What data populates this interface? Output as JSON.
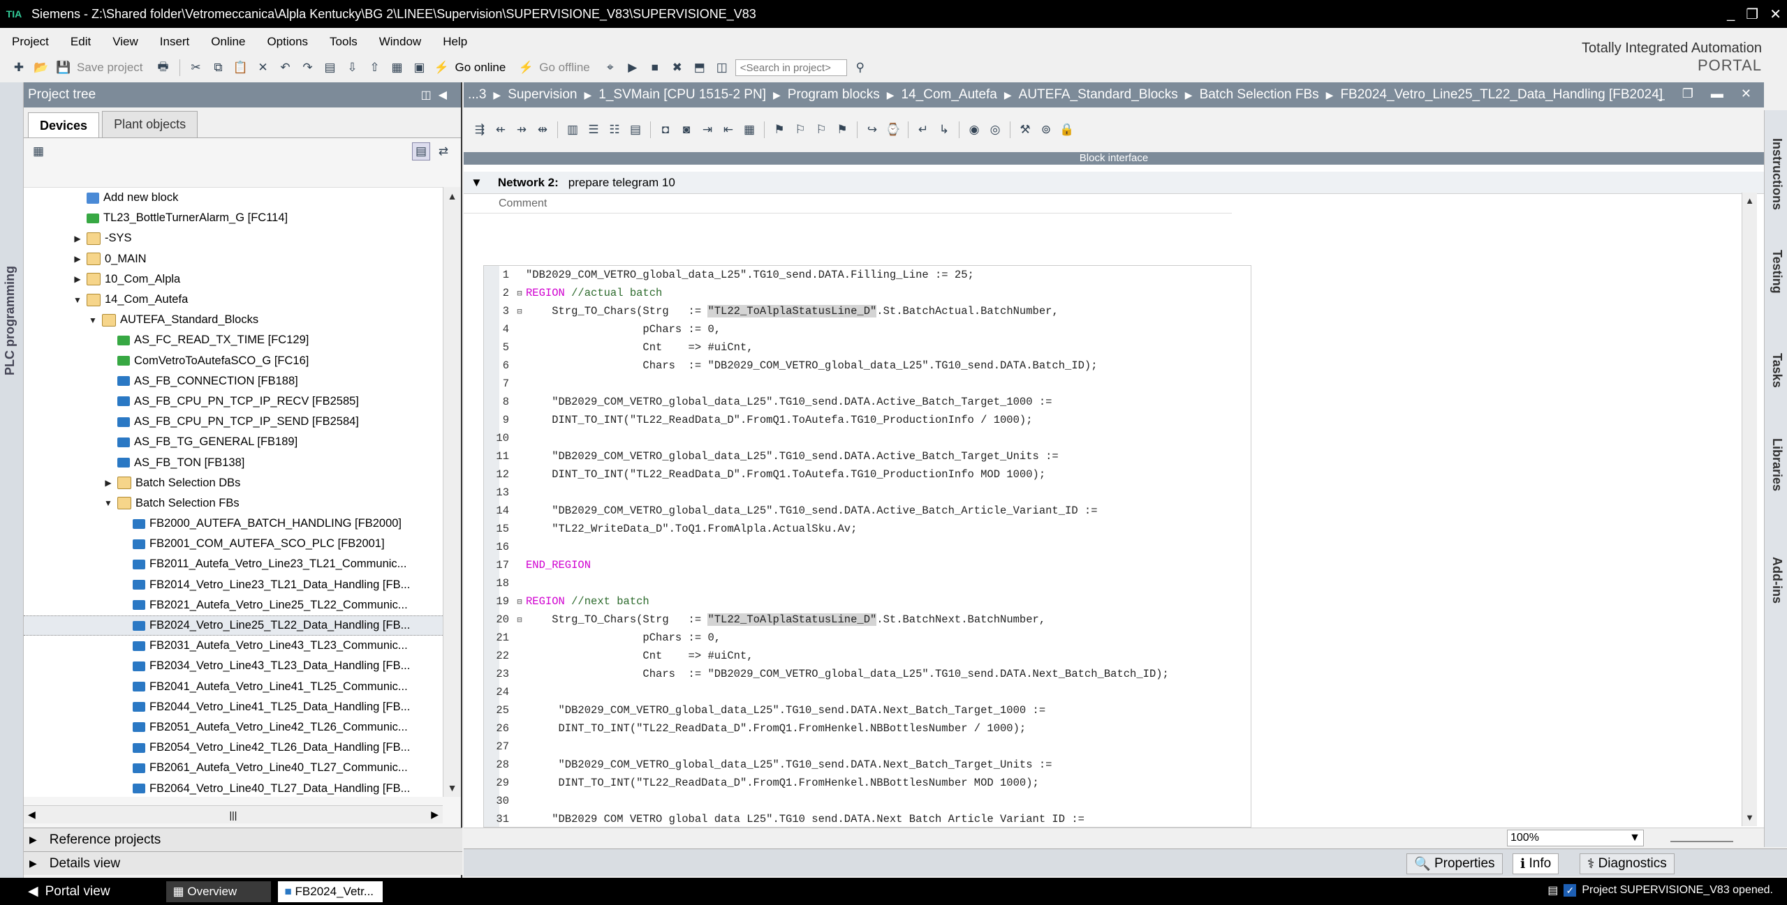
{
  "window": {
    "title": "Siemens  -  Z:\\Shared folder\\Vetromeccanica\\Alpla Kentucky\\BG 2\\LINEE\\Supervision\\SUPERVISIONE_V83\\SUPERVISIONE_V83",
    "minimize": "_",
    "restore": "❐",
    "close": "✕"
  },
  "menu": [
    "Project",
    "Edit",
    "View",
    "Insert",
    "Online",
    "Options",
    "Tools",
    "Window",
    "Help"
  ],
  "toolbar": {
    "save_label": "Save project",
    "go_online_label": "Go online",
    "go_offline_label": "Go offline",
    "search_placeholder": "<Search in project>"
  },
  "branding": {
    "line1": "Totally Integrated Automation",
    "line2": "PORTAL"
  },
  "side_strip": {
    "plc_label": "PLC programming"
  },
  "project_tree": {
    "title": "Project tree",
    "tabs": [
      "Devices",
      "Plant objects"
    ],
    "items": [
      {
        "label": "Add new block",
        "type": "add",
        "level": 4
      },
      {
        "label": "TL23_BottleTurnerAlarm_G [FC114]",
        "type": "fc",
        "level": 4
      },
      {
        "label": "-SYS",
        "type": "folder",
        "level": 4,
        "arrow": "▶"
      },
      {
        "label": "0_MAIN",
        "type": "folder",
        "level": 4,
        "arrow": "▶"
      },
      {
        "label": "10_Com_Alpla",
        "type": "folder",
        "level": 4,
        "arrow": "▶"
      },
      {
        "label": "14_Com_Autefa",
        "type": "folder",
        "level": 4,
        "arrow": "▼"
      },
      {
        "label": "AUTEFA_Standard_Blocks",
        "type": "folder",
        "level": 5,
        "arrow": "▼"
      },
      {
        "label": "AS_FC_READ_TX_TIME [FC129]",
        "type": "fc",
        "level": 6
      },
      {
        "label": "ComVetroToAutefaSCO_G [FC16]",
        "type": "fc",
        "level": 6
      },
      {
        "label": "AS_FB_CONNECTION [FB188]",
        "type": "fb",
        "level": 6
      },
      {
        "label": "AS_FB_CPU_PN_TCP_IP_RECV [FB2585]",
        "type": "fb",
        "level": 6
      },
      {
        "label": "AS_FB_CPU_PN_TCP_IP_SEND [FB2584]",
        "type": "fb",
        "level": 6
      },
      {
        "label": "AS_FB_TG_GENERAL [FB189]",
        "type": "fb",
        "level": 6
      },
      {
        "label": "AS_FB_TON [FB138]",
        "type": "fb",
        "level": 6
      },
      {
        "label": "Batch Selection DBs",
        "type": "folder",
        "level": 6,
        "arrow": "▶"
      },
      {
        "label": "Batch Selection FBs",
        "type": "folder",
        "level": 6,
        "arrow": "▼"
      },
      {
        "label": "FB2000_AUTEFA_BATCH_HANDLING [FB2000]",
        "type": "fb",
        "level": 7
      },
      {
        "label": "FB2001_COM_AUTEFA_SCO_PLC [FB2001]",
        "type": "fb",
        "level": 7
      },
      {
        "label": "FB2011_Autefa_Vetro_Line23_TL21_Communic...",
        "type": "fb",
        "level": 7
      },
      {
        "label": "FB2014_Vetro_Line23_TL21_Data_Handling [FB...",
        "type": "fb",
        "level": 7
      },
      {
        "label": "FB2021_Autefa_Vetro_Line25_TL22_Communic...",
        "type": "fb",
        "level": 7
      },
      {
        "label": "FB2024_Vetro_Line25_TL22_Data_Handling [FB...",
        "type": "fb",
        "level": 7,
        "selected": true
      },
      {
        "label": "FB2031_Autefa_Vetro_Line43_TL23_Communic...",
        "type": "fb",
        "level": 7
      },
      {
        "label": "FB2034_Vetro_Line43_TL23_Data_Handling [FB...",
        "type": "fb",
        "level": 7
      },
      {
        "label": "FB2041_Autefa_Vetro_Line41_TL25_Communic...",
        "type": "fb",
        "level": 7
      },
      {
        "label": "FB2044_Vetro_Line41_TL25_Data_Handling [FB...",
        "type": "fb",
        "level": 7
      },
      {
        "label": "FB2051_Autefa_Vetro_Line42_TL26_Communic...",
        "type": "fb",
        "level": 7
      },
      {
        "label": "FB2054_Vetro_Line42_TL26_Data_Handling [FB...",
        "type": "fb",
        "level": 7
      },
      {
        "label": "FB2061_Autefa_Vetro_Line40_TL27_Communic...",
        "type": "fb",
        "level": 7
      },
      {
        "label": "FB2064_Vetro_Line40_TL27_Data_Handling [FB...",
        "type": "fb",
        "level": 7
      }
    ],
    "reference_projects": "Reference projects",
    "details_view": "Details view"
  },
  "editor": {
    "breadcrumb": [
      "...3",
      "Supervision",
      "1_SVMain [CPU 1515-2 PN]",
      "Program blocks",
      "14_Com_Autefa",
      "AUTEFA_Standard_Blocks",
      "Batch Selection FBs",
      "FB2024_Vetro_Line25_TL22_Data_Handling [FB2024]"
    ],
    "block_interface": "Block interface",
    "network_label": "Network 2:",
    "network_title": "prepare telegram 10",
    "comment_label": "Comment",
    "zoom": "100%",
    "code": [
      {
        "n": "1",
        "fold": "",
        "segs": [
          {
            "t": "\"DB2029_COM_VETRO_global_data_L25\".TG10_send.DATA.Filling_Line := 25;"
          }
        ]
      },
      {
        "n": "2",
        "fold": "⊟",
        "segs": [
          {
            "t": "REGION",
            "c": "kw"
          },
          {
            "t": " //actual batch",
            "c": "cm"
          }
        ]
      },
      {
        "n": "3",
        "fold": "⊟",
        "segs": [
          {
            "t": "    Strg_TO_Chars(Strg   := "
          },
          {
            "t": "\"TL22_ToAlplaStatusLine_D\"",
            "c": "hl"
          },
          {
            "t": ".St.BatchActual.BatchNumber,"
          }
        ]
      },
      {
        "n": "4",
        "fold": "",
        "segs": [
          {
            "t": "                  pChars := 0,"
          }
        ]
      },
      {
        "n": "5",
        "fold": "",
        "segs": [
          {
            "t": "                  Cnt    => #uiCnt,"
          }
        ]
      },
      {
        "n": "6",
        "fold": "",
        "segs": [
          {
            "t": "                  Chars  := \"DB2029_COM_VETRO_global_data_L25\".TG10_send.DATA.Batch_ID);"
          }
        ]
      },
      {
        "n": "7",
        "fold": "",
        "segs": [
          {
            "t": ""
          }
        ]
      },
      {
        "n": "8",
        "fold": "",
        "segs": [
          {
            "t": "    \"DB2029_COM_VETRO_global_data_L25\".TG10_send.DATA.Active_Batch_Target_1000 :="
          }
        ]
      },
      {
        "n": "9",
        "fold": "",
        "segs": [
          {
            "t": "    DINT_TO_INT(\"TL22_ReadData_D\".FromQ1.ToAutefa.TG10_ProductionInfo / 1000);"
          }
        ]
      },
      {
        "n": "10",
        "fold": "",
        "segs": [
          {
            "t": ""
          }
        ]
      },
      {
        "n": "11",
        "fold": "",
        "segs": [
          {
            "t": "    \"DB2029_COM_VETRO_global_data_L25\".TG10_send.DATA.Active_Batch_Target_Units :="
          }
        ]
      },
      {
        "n": "12",
        "fold": "",
        "segs": [
          {
            "t": "    DINT_TO_INT(\"TL22_ReadData_D\".FromQ1.ToAutefa.TG10_ProductionInfo MOD 1000);"
          }
        ]
      },
      {
        "n": "13",
        "fold": "",
        "segs": [
          {
            "t": ""
          }
        ]
      },
      {
        "n": "14",
        "fold": "",
        "segs": [
          {
            "t": "    \"DB2029_COM_VETRO_global_data_L25\".TG10_send.DATA.Active_Batch_Article_Variant_ID :="
          }
        ]
      },
      {
        "n": "15",
        "fold": "",
        "segs": [
          {
            "t": "    \"TL22_WriteData_D\".ToQ1.FromAlpla.ActualSku.Av;"
          }
        ]
      },
      {
        "n": "16",
        "fold": "",
        "segs": [
          {
            "t": ""
          }
        ]
      },
      {
        "n": "17",
        "fold": "",
        "segs": [
          {
            "t": "END_REGION",
            "c": "kw"
          }
        ]
      },
      {
        "n": "18",
        "fold": "",
        "segs": [
          {
            "t": ""
          }
        ]
      },
      {
        "n": "19",
        "fold": "⊟",
        "segs": [
          {
            "t": "REGION",
            "c": "kw"
          },
          {
            "t": " //next batch",
            "c": "cm"
          }
        ]
      },
      {
        "n": "20",
        "fold": "⊟",
        "segs": [
          {
            "t": "    Strg_TO_Chars(Strg   := "
          },
          {
            "t": "\"TL22_ToAlplaStatusLine_D\"",
            "c": "hl"
          },
          {
            "t": ".St.BatchNext.BatchNumber,"
          }
        ]
      },
      {
        "n": "21",
        "fold": "",
        "segs": [
          {
            "t": "                  pChars := 0,"
          }
        ]
      },
      {
        "n": "22",
        "fold": "",
        "segs": [
          {
            "t": "                  Cnt    => #uiCnt,"
          }
        ]
      },
      {
        "n": "23",
        "fold": "",
        "segs": [
          {
            "t": "                  Chars  := \"DB2029_COM_VETRO_global_data_L25\".TG10_send.DATA.Next_Batch_Batch_ID);"
          }
        ]
      },
      {
        "n": "24",
        "fold": "",
        "segs": [
          {
            "t": ""
          }
        ]
      },
      {
        "n": "25",
        "fold": "",
        "segs": [
          {
            "t": "     \"DB2029_COM_VETRO_global_data_L25\".TG10_send.DATA.Next_Batch_Target_1000 :="
          }
        ]
      },
      {
        "n": "26",
        "fold": "",
        "segs": [
          {
            "t": "     DINT_TO_INT(\"TL22_ReadData_D\".FromQ1.FromHenkel.NBBottlesNumber / 1000);"
          }
        ]
      },
      {
        "n": "27",
        "fold": "",
        "segs": [
          {
            "t": ""
          }
        ]
      },
      {
        "n": "28",
        "fold": "",
        "segs": [
          {
            "t": "     \"DB2029_COM_VETRO_global_data_L25\".TG10_send.DATA.Next_Batch_Target_Units :="
          }
        ]
      },
      {
        "n": "29",
        "fold": "",
        "segs": [
          {
            "t": "     DINT_TO_INT(\"TL22_ReadData_D\".FromQ1.FromHenkel.NBBottlesNumber MOD 1000);"
          }
        ]
      },
      {
        "n": "30",
        "fold": "",
        "segs": [
          {
            "t": ""
          }
        ]
      },
      {
        "n": "31",
        "fold": "",
        "segs": [
          {
            "t": "    \"DB2029 COM VETRO global data L25\".TG10 send.DATA.Next Batch Article Variant ID :="
          }
        ]
      }
    ]
  },
  "right_tabs": [
    "Instructions",
    "Testing",
    "Tasks",
    "Libraries",
    "Add-ins"
  ],
  "inspector": {
    "properties": "Properties",
    "info": "Info",
    "diagnostics": "Diagnostics"
  },
  "taskbar": {
    "portal_view": "Portal view",
    "overview": "Overview",
    "open_block": "FB2024_Vetr...",
    "status": "Project SUPERVISIONE_V83 opened."
  }
}
